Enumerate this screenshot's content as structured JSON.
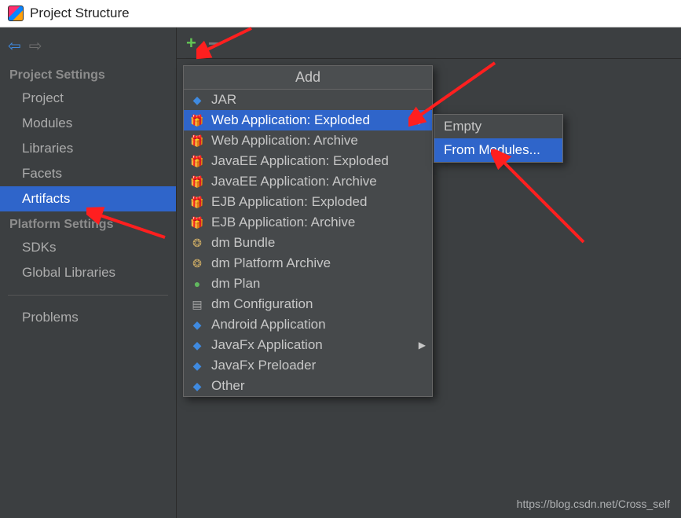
{
  "window": {
    "title": "Project Structure"
  },
  "sidebar": {
    "section1": "Project Settings",
    "items1": [
      "Project",
      "Modules",
      "Libraries",
      "Facets",
      "Artifacts"
    ],
    "selected1": 4,
    "section2": "Platform Settings",
    "items2": [
      "SDKs",
      "Global Libraries"
    ],
    "section3_items": [
      "Problems"
    ]
  },
  "popup": {
    "title": "Add",
    "items": [
      {
        "label": "JAR",
        "icon": "diamond"
      },
      {
        "label": "Web Application: Exploded",
        "icon": "gift",
        "submenu": true,
        "selected": true
      },
      {
        "label": "Web Application: Archive",
        "icon": "gift"
      },
      {
        "label": "JavaEE Application: Exploded",
        "icon": "gift"
      },
      {
        "label": "JavaEE Application: Archive",
        "icon": "gift"
      },
      {
        "label": "EJB Application: Exploded",
        "icon": "gift"
      },
      {
        "label": "EJB Application: Archive",
        "icon": "gift"
      },
      {
        "label": "dm Bundle",
        "icon": "bundle"
      },
      {
        "label": "dm Platform Archive",
        "icon": "bundle"
      },
      {
        "label": "dm Plan",
        "icon": "green"
      },
      {
        "label": "dm Configuration",
        "icon": "page"
      },
      {
        "label": "Android Application",
        "icon": "diamond"
      },
      {
        "label": "JavaFx Application",
        "icon": "diamond",
        "submenu": true
      },
      {
        "label": "JavaFx Preloader",
        "icon": "diamond"
      },
      {
        "label": "Other",
        "icon": "diamond"
      }
    ]
  },
  "submenu": {
    "items": [
      "Empty",
      "From Modules..."
    ],
    "selected": 1
  },
  "watermark": "https://blog.csdn.net/Cross_self"
}
